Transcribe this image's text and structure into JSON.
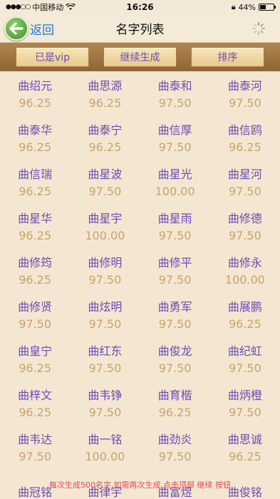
{
  "status": {
    "carrier": "中国移动",
    "time": "16:26",
    "battery": "44%",
    "battery_level": 0.44
  },
  "nav": {
    "back_label": "返回",
    "title": "名字列表"
  },
  "toolbar": {
    "vip_label": "已是vip",
    "continue_label": "继续生成",
    "sort_label": "排序"
  },
  "names": [
    {
      "name": "曲绍元",
      "score": "96.25"
    },
    {
      "name": "曲思源",
      "score": "96.25"
    },
    {
      "name": "曲泰和",
      "score": "97.50"
    },
    {
      "name": "曲泰河",
      "score": "97.50"
    },
    {
      "name": "曲泰华",
      "score": "96.25"
    },
    {
      "name": "曲泰宁",
      "score": "96.25"
    },
    {
      "name": "曲信厚",
      "score": "97.50"
    },
    {
      "name": "曲信鸥",
      "score": "96.25"
    },
    {
      "name": "曲信瑞",
      "score": "96.25"
    },
    {
      "name": "曲星波",
      "score": "97.50"
    },
    {
      "name": "曲星光",
      "score": "100.00"
    },
    {
      "name": "曲星河",
      "score": "97.50"
    },
    {
      "name": "曲星华",
      "score": "96.25"
    },
    {
      "name": "曲星宇",
      "score": "100.00"
    },
    {
      "name": "曲星雨",
      "score": "97.50"
    },
    {
      "name": "曲修德",
      "score": "97.50"
    },
    {
      "name": "曲修筠",
      "score": "96.25"
    },
    {
      "name": "曲修明",
      "score": "97.50"
    },
    {
      "name": "曲修平",
      "score": "97.50"
    },
    {
      "name": "曲修永",
      "score": "100.00"
    },
    {
      "name": "曲修贤",
      "score": "97.50"
    },
    {
      "name": "曲炫明",
      "score": "97.50"
    },
    {
      "name": "曲勇军",
      "score": "97.50"
    },
    {
      "name": "曲展鹏",
      "score": "96.25"
    },
    {
      "name": "曲皇宁",
      "score": "96.25"
    },
    {
      "name": "曲红东",
      "score": "97.50"
    },
    {
      "name": "曲俊龙",
      "score": "97.50"
    },
    {
      "name": "曲纪虹",
      "score": "97.50"
    },
    {
      "name": "曲梓文",
      "score": "96.25"
    },
    {
      "name": "曲韦铮",
      "score": "97.50"
    },
    {
      "name": "曲育楷",
      "score": "96.25"
    },
    {
      "name": "曲炳橙",
      "score": "97.50"
    },
    {
      "name": "曲韦达",
      "score": "97.50"
    },
    {
      "name": "曲一铭",
      "score": "100.00"
    },
    {
      "name": "曲劲炎",
      "score": "97.50"
    },
    {
      "name": "曲思诚",
      "score": "96.25"
    },
    {
      "name": "曲冠铭",
      "score": ""
    },
    {
      "name": "曲律宇",
      "score": ""
    },
    {
      "name": "曲富煜",
      "score": ""
    },
    {
      "name": "曲俊铭",
      "score": ""
    }
  ],
  "footer_message": "每次生成500名字,如需再次生成,点击顶部 继续 按钮",
  "colors": {
    "name": "#6b4db3",
    "score": "#c9a36b",
    "back": "#1b7bd6",
    "toolbar": "#8e6534",
    "footer": "#e1495a"
  },
  "icons": {
    "back": "back-arrow-icon",
    "loading": "loading-spinner-icon",
    "wifi": "wifi-icon",
    "battery": "battery-icon"
  }
}
